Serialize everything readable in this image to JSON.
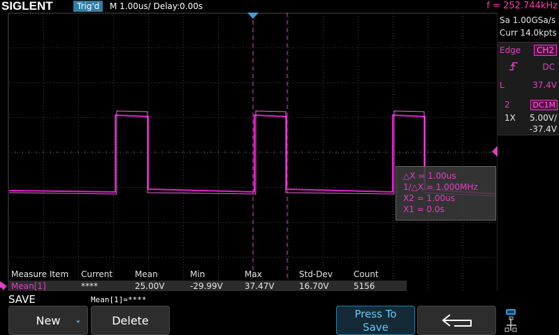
{
  "header": {
    "brand": "SIGLENT",
    "trigger_status": "Trig'd",
    "timebase": "M 1.00us/ Delay:0.00s",
    "frequency": "f = 252.744kHz"
  },
  "right_panel": {
    "sample_rate": "Sa 1.00GSa/s",
    "memory_depth": "Curr 14.0kpts",
    "trigger": {
      "type": "Edge",
      "source": "CH2",
      "coupling": "DC",
      "level_label": "L",
      "level": "37.4V",
      "slope_icon": "rising-edge-icon"
    },
    "channel": {
      "number": "2",
      "coupling": "DC1M",
      "probe": "1X",
      "scale": "5.00V/",
      "offset": "-37.4V"
    }
  },
  "cursor_box": {
    "delta_x": "△X = 1.00us",
    "inv_delta_x": "1/△X = 1.000MHz",
    "x2": "X2 = 1.00us",
    "x1": "X1 = 0.0s"
  },
  "measure": {
    "headers": [
      "Measure Item",
      "Current",
      "Mean",
      "Min",
      "Max",
      "Std-Dev",
      "Count"
    ],
    "row": {
      "item": "Mean[1]",
      "current": "****",
      "mean": "25.00V",
      "min": "-29.99V",
      "max": "37.47V",
      "std_dev": "16.70V",
      "count": "5156"
    }
  },
  "menu": {
    "title": "SAVE",
    "status": "Mean[1]=****",
    "new_label": "New",
    "delete_label": "Delete",
    "press_line1": "Press To",
    "press_line2": "Save"
  },
  "colors": {
    "trace": "#e81ed2",
    "accent": "#2f7fa8",
    "grid": "#4a4a4a"
  }
}
